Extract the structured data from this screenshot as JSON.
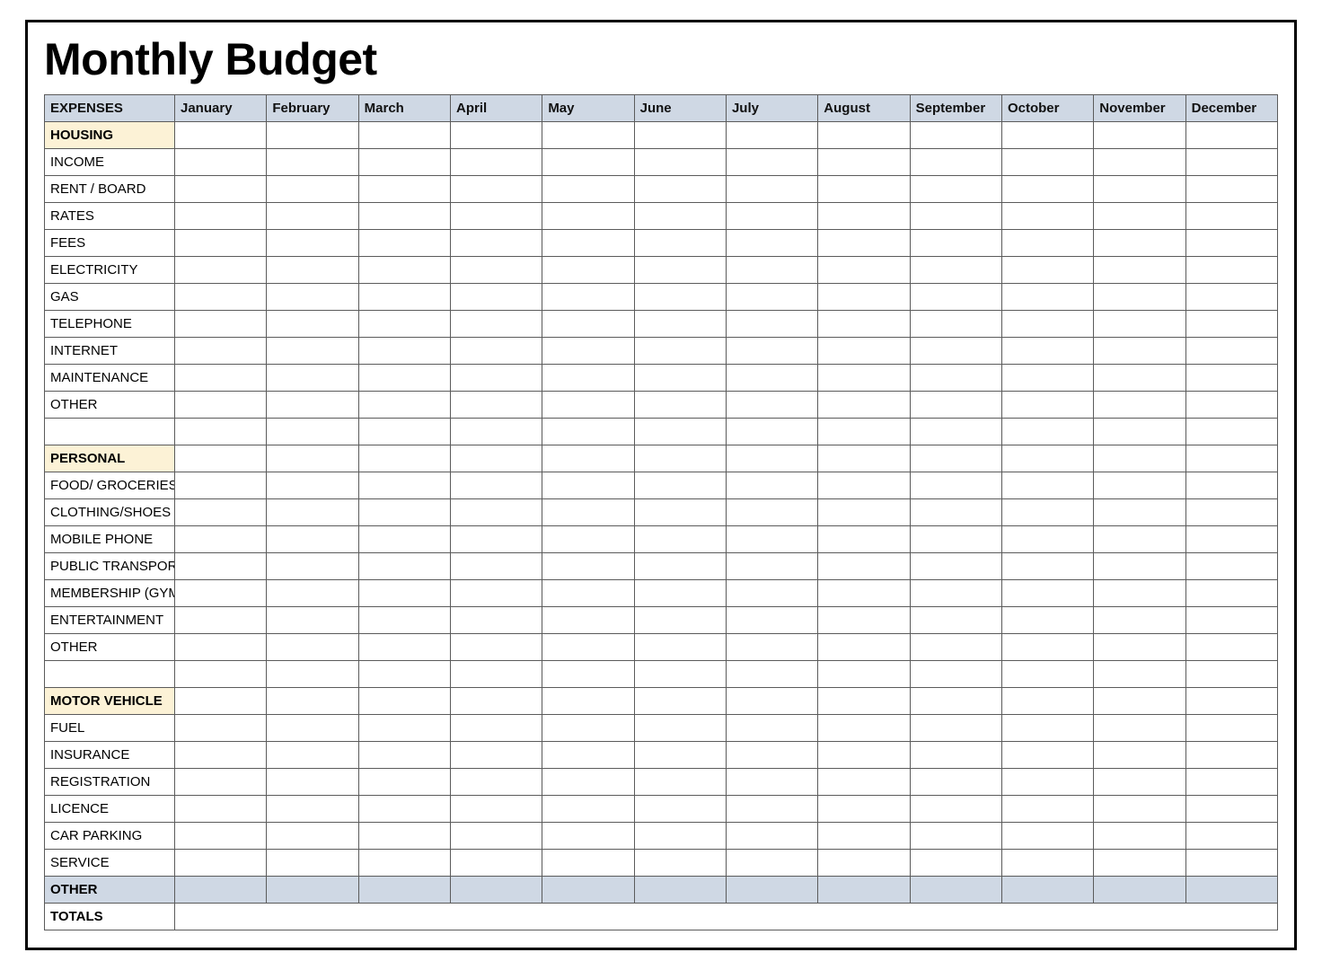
{
  "title": "Monthly Budget",
  "header": {
    "label_col": "EXPENSES",
    "months": [
      "January",
      "February",
      "March",
      "April",
      "May",
      "June",
      "July",
      "August",
      "September",
      "October",
      "November",
      "December"
    ]
  },
  "sections": [
    {
      "name": "HOUSING",
      "rows": [
        "INCOME",
        "RENT / BOARD",
        "RATES",
        "FEES",
        "ELECTRICITY",
        "GAS",
        "TELEPHONE",
        "INTERNET",
        "MAINTENANCE",
        "OTHER"
      ],
      "spacer_after": true
    },
    {
      "name": "PERSONAL",
      "rows": [
        "FOOD/ GROCERIES",
        "CLOTHING/SHOES",
        "MOBILE PHONE",
        "PUBLIC TRANSPORT",
        "MEMBERSHIP (GYM)",
        "ENTERTAINMENT",
        "OTHER"
      ],
      "spacer_after": true
    },
    {
      "name": "MOTOR VEHICLE",
      "rows": [
        "FUEL",
        "INSURANCE",
        "REGISTRATION",
        "LICENCE",
        "CAR PARKING",
        "SERVICE"
      ],
      "spacer_after": false
    }
  ],
  "other_row_label": "OTHER",
  "totals_row_label": "TOTALS"
}
